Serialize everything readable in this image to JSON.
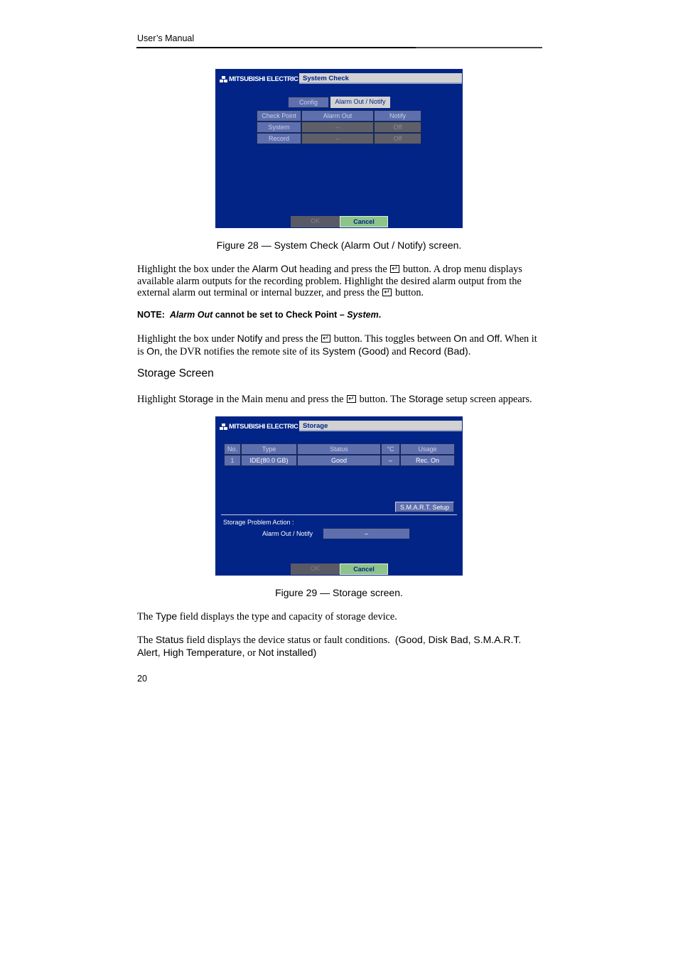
{
  "header": {
    "title": "User’s Manual"
  },
  "figure28": {
    "brand": "MITSUBISHI ELECTRIC",
    "title": "System Check",
    "tabs": [
      {
        "label": "Config",
        "active": false
      },
      {
        "label": "Alarm Out / Notify",
        "active": true
      }
    ],
    "columns": [
      "Check Point",
      "Alarm Out",
      "Notify"
    ],
    "rows": [
      {
        "check_point": "System",
        "alarm_out": "–",
        "notify": "Off"
      },
      {
        "check_point": "Record",
        "alarm_out": "–",
        "notify": "Off"
      }
    ],
    "ok_label": "OK",
    "cancel_label": "Cancel",
    "caption": "Figure 28 — System Check (Alarm Out / Notify) screen."
  },
  "para1": {
    "t1": "Highlight the box under the ",
    "k1": "Alarm Out",
    "t2": " heading and press the ",
    "t3": " button.  A drop menu displays available alarm outputs for the recording problem.  Highlight the desired alarm output from the external alarm out terminal or internal buzzer, and press the ",
    "t4": " button."
  },
  "note": {
    "prefix": "NOTE:  ",
    "k1": "Alarm Out",
    "mid": " cannot be set to Check Point – ",
    "k2": "System",
    "end": "."
  },
  "para2": {
    "t1": "Highlight the box under ",
    "k1": "Notify",
    "t2": " and press the ",
    "t3": " button.  This toggles between ",
    "k2": "On",
    "t4": " and ",
    "k3": "Off",
    "t5": ".  When it is ",
    "k4": "On",
    "t6": ", the DVR notifies the remote site of its ",
    "k5": "System (Good)",
    "t7": " and ",
    "k6": "Record (Bad)",
    "t8": "."
  },
  "section": {
    "title": "Storage Screen"
  },
  "para3": {
    "t1": "Highlight ",
    "k1": "Storage",
    "t2": " in the Main menu and press the ",
    "t3": " button.  The ",
    "k2": "Storage",
    "t4": " setup screen appears."
  },
  "figure29": {
    "brand": "MITSUBISHI ELECTRIC",
    "title": "Storage",
    "columns": [
      "No.",
      "Type",
      "Status",
      "°C",
      "Usage"
    ],
    "rows": [
      {
        "no": "1",
        "type": "IDE(80.0 GB)",
        "status": "Good",
        "temp": "–",
        "usage": "Rec. On"
      }
    ],
    "smart_label": "S.M.A.R.T. Setup",
    "problem_action_label": "Storage Problem Action :",
    "alarm_notify_label": "Alarm Out / Notify",
    "alarm_notify_value": "–",
    "ok_label": "OK",
    "cancel_label": "Cancel",
    "caption": "Figure 29 — Storage screen."
  },
  "para4": {
    "t1": "The ",
    "k1": "Type",
    "t2": " field displays the type and capacity of storage device."
  },
  "para5": {
    "t1": "The ",
    "k1": "Status",
    "t2": " field displays the device status or fault conditions.  ",
    "k2": "(Good, Disk Bad, S.M.A.R.T. Alert, High Temperature,",
    "t3": " or ",
    "k3": "Not installed)"
  },
  "page_number": "20",
  "colors": {
    "screen_bg": "#022486",
    "header_cell": "#5f6fae",
    "disabled_cell": "#5f5f6a",
    "cancel_button": "#8ec48a"
  }
}
